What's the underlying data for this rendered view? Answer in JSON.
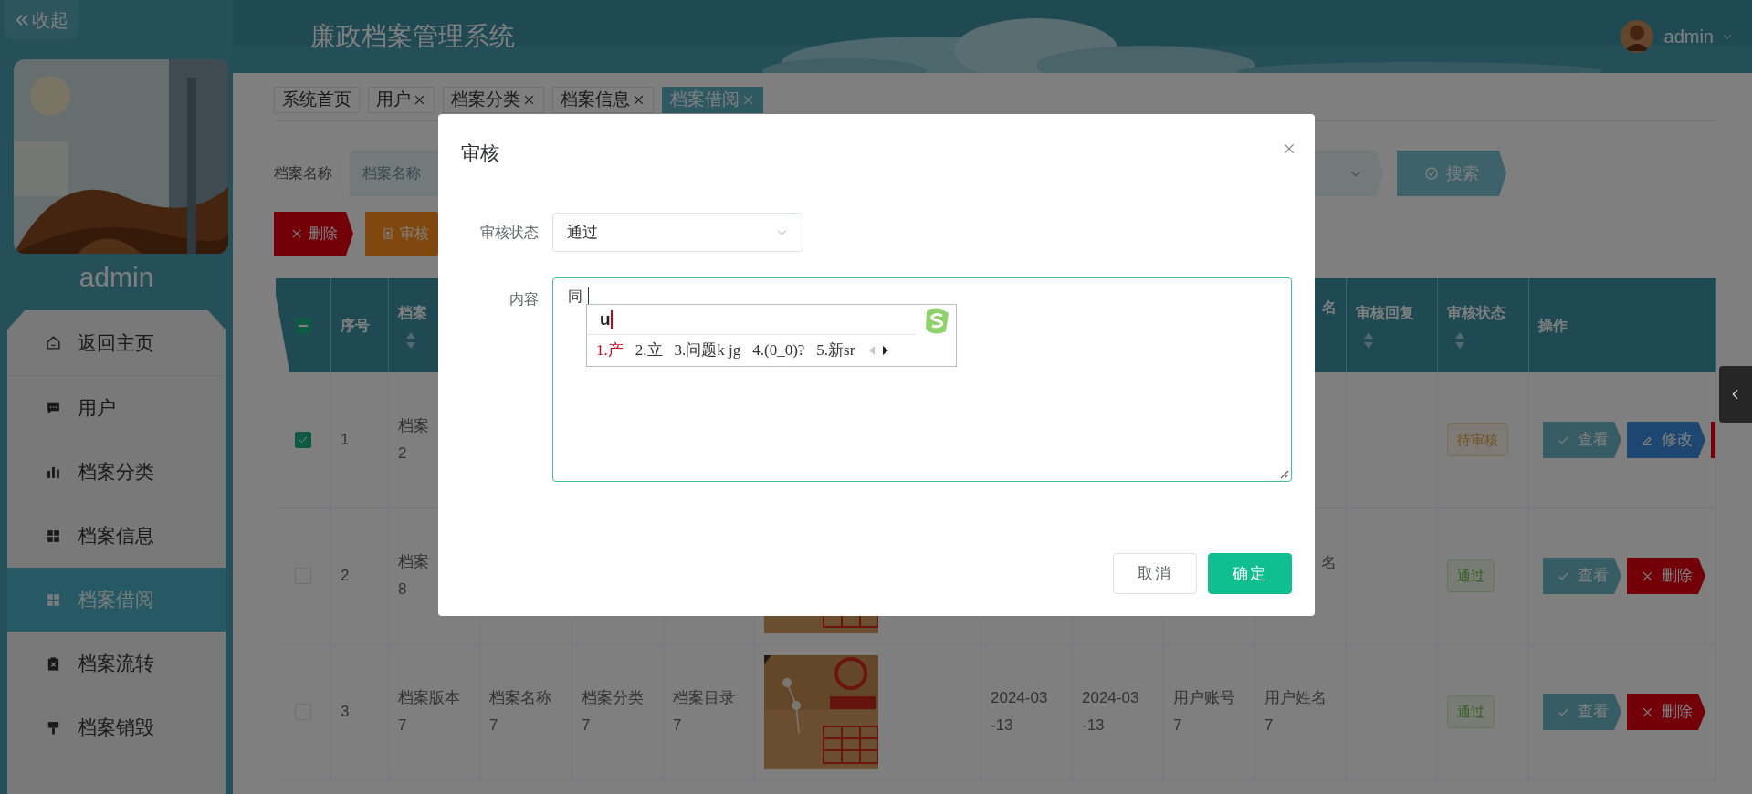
{
  "sidebar": {
    "collapse_button": "收起",
    "username": "admin",
    "menu": [
      {
        "label": "返回主页",
        "selected": false
      },
      {
        "label": "用户",
        "selected": false
      },
      {
        "label": "档案分类",
        "selected": false
      },
      {
        "label": "档案信息",
        "selected": false
      },
      {
        "label": "档案借阅",
        "selected": true
      },
      {
        "label": "档案流转",
        "selected": false
      },
      {
        "label": "档案销毁",
        "selected": false
      }
    ]
  },
  "header": {
    "title": "廉政档案管理系统",
    "user": "admin"
  },
  "tabs": [
    {
      "label": "系统首页",
      "closable": false,
      "selected": false
    },
    {
      "label": "用户",
      "closable": true,
      "selected": false
    },
    {
      "label": "档案分类",
      "closable": true,
      "selected": false
    },
    {
      "label": "档案信息",
      "closable": true,
      "selected": false
    },
    {
      "label": "档案借阅",
      "closable": true,
      "selected": true
    }
  ],
  "search": {
    "label": "档案名称",
    "placeholder": "档案名称",
    "button": "搜索"
  },
  "toolbar": [
    {
      "kind": "delete",
      "label": "删除"
    },
    {
      "kind": "review",
      "label": "审核"
    }
  ],
  "table": {
    "select_all": {
      "indeterminate": true
    },
    "columns": [
      {
        "label": "序号",
        "sortable": false
      },
      {
        "label": "档案",
        "sortable": true
      },
      {
        "label": "名",
        "sortable": false
      },
      {
        "label": "审核回复",
        "sortable": true
      },
      {
        "label": "审核状态",
        "sortable": true
      },
      {
        "label": "操作",
        "sortable": false
      }
    ],
    "rows": [
      {
        "selected": true,
        "index": "1",
        "version": "档案2",
        "status": {
          "label": "待审核",
          "kind": "pending"
        },
        "actions": [
          {
            "kind": "view",
            "label": "查看"
          },
          {
            "kind": "edit",
            "label": "修改"
          },
          {
            "kind": "delete"
          }
        ]
      },
      {
        "selected": false,
        "index": "2",
        "version": "档案8",
        "cover": {
          "kind": "picture"
        },
        "user_name": "名",
        "status": {
          "label": "通过",
          "kind": "approved"
        },
        "actions": [
          {
            "kind": "view",
            "label": "查看"
          },
          {
            "kind": "delete",
            "label": "删除"
          }
        ]
      },
      {
        "selected": false,
        "index": "3",
        "version": "档案版本7",
        "name": "档案名称7",
        "category": "档案分类7",
        "catalog": "档案目录7",
        "cover": {
          "kind": "picture"
        },
        "column_8": "2024-03-13",
        "column_9": "2024-03-13",
        "account": "用户账号7",
        "user_name": "用户姓名7",
        "status": {
          "label": "通过",
          "kind": "approved"
        },
        "actions": [
          {
            "kind": "view",
            "label": "查看"
          },
          {
            "kind": "delete",
            "label": "删除"
          }
        ]
      }
    ]
  },
  "dialog": {
    "title": "审核",
    "fields": [
      {
        "kind": "select",
        "label": "审核状态",
        "value": "通过"
      },
      {
        "kind": "textarea",
        "label": "内容",
        "value": "同"
      }
    ],
    "buttons": [
      {
        "kind": "cancel",
        "label": "取消"
      },
      {
        "kind": "confirm",
        "label": "确定"
      }
    ]
  },
  "ime": {
    "composition": "u",
    "candidates": [
      {
        "label": "1.产",
        "selected": true
      },
      {
        "label": "2.立",
        "selected": false
      },
      {
        "label": "3.问题k jg",
        "selected": false
      },
      {
        "label": "4.(0_0)?",
        "selected": false
      },
      {
        "label": "5.新sr",
        "selected": false
      }
    ],
    "paging": {
      "prev_enabled": false,
      "next_enabled": true
    }
  }
}
